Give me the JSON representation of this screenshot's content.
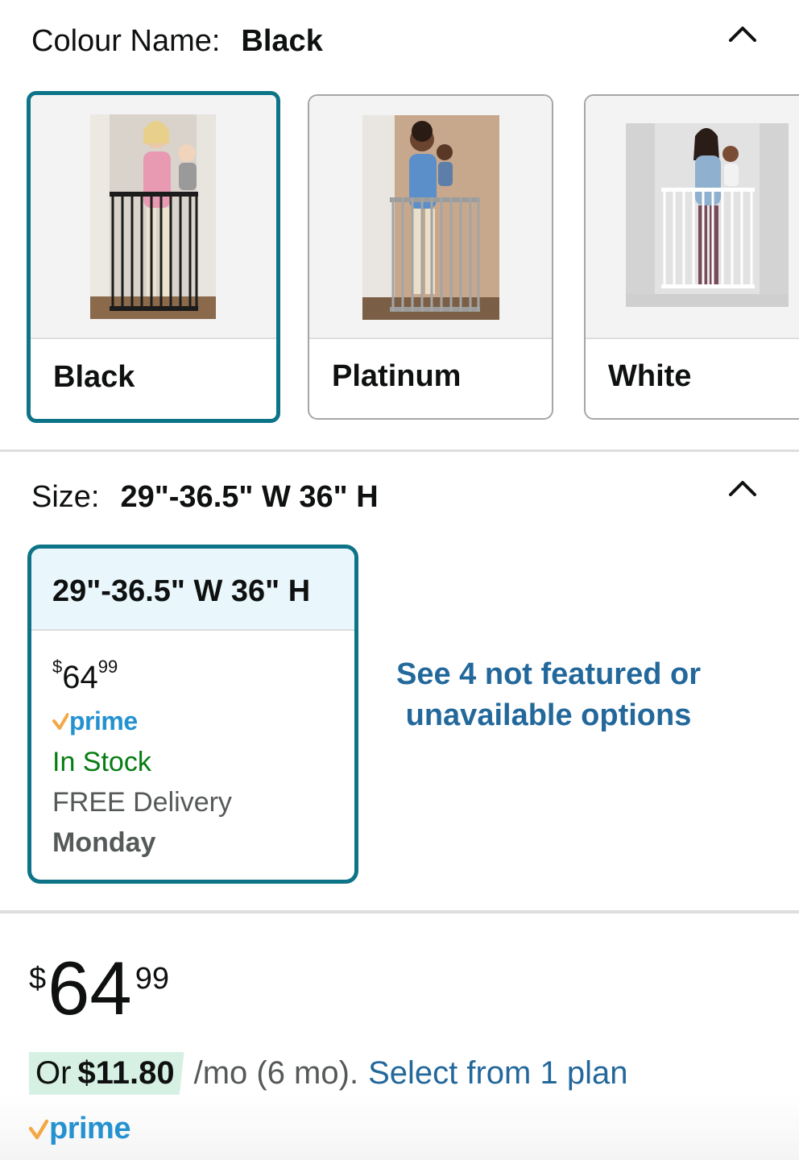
{
  "colour_section": {
    "label": "Colour Name:",
    "selected_value": "Black",
    "collapse_icon": "chevron-up-icon",
    "options": [
      {
        "label": "Black",
        "selected": true,
        "image": "black-baby-gate-photo"
      },
      {
        "label": "Platinum",
        "selected": false,
        "image": "platinum-baby-gate-photo"
      },
      {
        "label": "White",
        "selected": false,
        "image": "white-baby-gate-photo"
      }
    ]
  },
  "size_section": {
    "label": "Size:",
    "selected_value": "29\"-36.5\" W 36\" H",
    "collapse_icon": "chevron-up-icon",
    "card": {
      "title": "29\"-36.5\" W 36\" H",
      "price_currency": "$",
      "price_whole": "64",
      "price_fraction": "99",
      "prime_label": "prime",
      "stock": "In Stock",
      "delivery": "FREE Delivery",
      "delivery_day": "Monday"
    },
    "see_more": "See 4 not featured or unavailable options"
  },
  "price": {
    "currency": "$",
    "whole": "64",
    "fraction": "99"
  },
  "plan": {
    "or": "Or",
    "amount": "$11.80",
    "term": "/mo (6 mo).",
    "link": "Select from 1 plan"
  },
  "prime_badge": "prime",
  "colors": {
    "selected_border": "#0d7488",
    "link": "#23689b",
    "stock_green": "#067d12",
    "prime_blue": "#2592d0",
    "prime_check": "#f3a847",
    "size_head_bg": "#e9f7fc",
    "plan_highlight": "#d6f1e4"
  }
}
